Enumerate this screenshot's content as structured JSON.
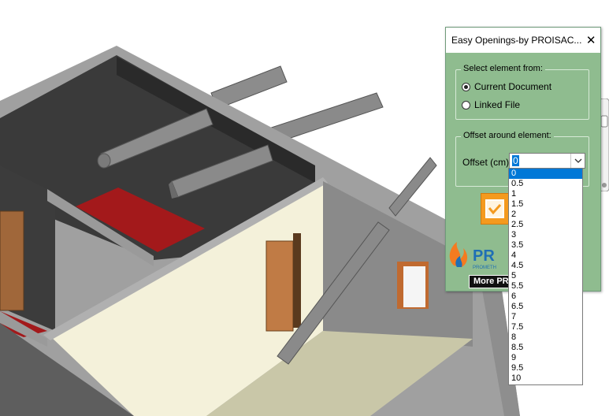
{
  "dialog": {
    "title": "Easy Openings-by PROISAC...",
    "close_glyph": "✕",
    "select_group_label": "Select element from:",
    "radio_current": "Current Document",
    "radio_linked": "Linked File",
    "selected_source": "Current Document",
    "offset_group_label": "Offset around element:",
    "offset_label": "Offset (cm)",
    "offset_value": "0",
    "action_icon": "orange-heart-badge-icon",
    "brand_text": "PR",
    "brand_subtext": "PROMETH",
    "more_button": "More PR"
  },
  "dropdown": {
    "options": [
      "0",
      "0.5",
      "1",
      "1.5",
      "2",
      "2.5",
      "3",
      "3.5",
      "4",
      "4.5",
      "5",
      "5.5",
      "6",
      "6.5",
      "7",
      "7.5",
      "8",
      "8.5",
      "9",
      "9.5",
      "10"
    ],
    "selected": "0"
  },
  "colors": {
    "dialog_bg": "#8fbc8f",
    "selection_blue": "#0078d7",
    "icon_orange": "#f49a1e",
    "floor_red": "#a3191b"
  }
}
